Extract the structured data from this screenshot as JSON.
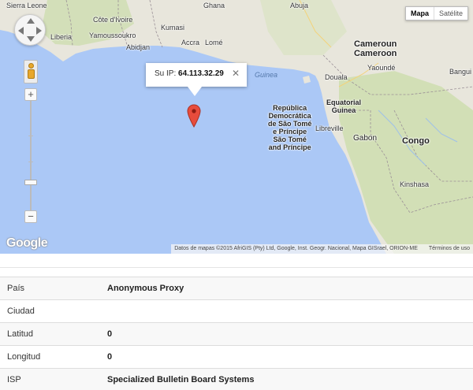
{
  "map": {
    "map_type": {
      "options": [
        "Mapa",
        "Satélite"
      ],
      "active": "Mapa"
    },
    "places": {
      "sierra_leone": "Sierra Leone",
      "ghana": "Ghana",
      "abuja": "Abuja",
      "liberia": "Liberia",
      "cote_divoire": "Côte d'Ivoire",
      "kumasi": "Kumasi",
      "yamoussoukro": "Yamoussoukro",
      "accra": "Accra",
      "lome": "Lomé",
      "abidjan": "Abidjan",
      "cameroun_1": "Cameroun",
      "cameroun_2": "Cameroon",
      "yaounde": "Yaoundé",
      "douala": "Douala",
      "guinea_sea": "Guinea",
      "equatorial_guinea": "Equatorial\nGuinea",
      "sao_tome": "República\nDemocrática\nde São Tomé\ne Príncipe\nSão Tomé\nand Príncipe",
      "libreville": "Libreville",
      "gabon": "Gabon",
      "congo": "Congo",
      "kinshasa": "Kinshasa",
      "bangui": "Bangui",
      "cut_1": "ı",
      "cut_2": "ı"
    },
    "info_window": {
      "label": "Su IP:",
      "ip": "64.113.32.29",
      "close": "✕"
    },
    "logo": "Google",
    "attribution": "Datos de mapas ©2015 AfriGIS (Pty) Ltd, Google, Inst. Geogr. Nacional, Mapa GISrael, ORION-ME",
    "terms": "Términos de uso",
    "zoom_in": "+",
    "zoom_out": "−"
  },
  "details": [
    {
      "label": "País",
      "value": "Anonymous Proxy"
    },
    {
      "label": "Ciudad",
      "value": ""
    },
    {
      "label": "Latitud",
      "value": "0"
    },
    {
      "label": "Longitud",
      "value": "0"
    },
    {
      "label": "ISP",
      "value": "Specialized Bulletin Board Systems"
    }
  ],
  "colors": {
    "sea": "#abc8f6",
    "land": "#e8e6dc",
    "green": "#cbdcaa",
    "pin": "#e74c3c"
  }
}
